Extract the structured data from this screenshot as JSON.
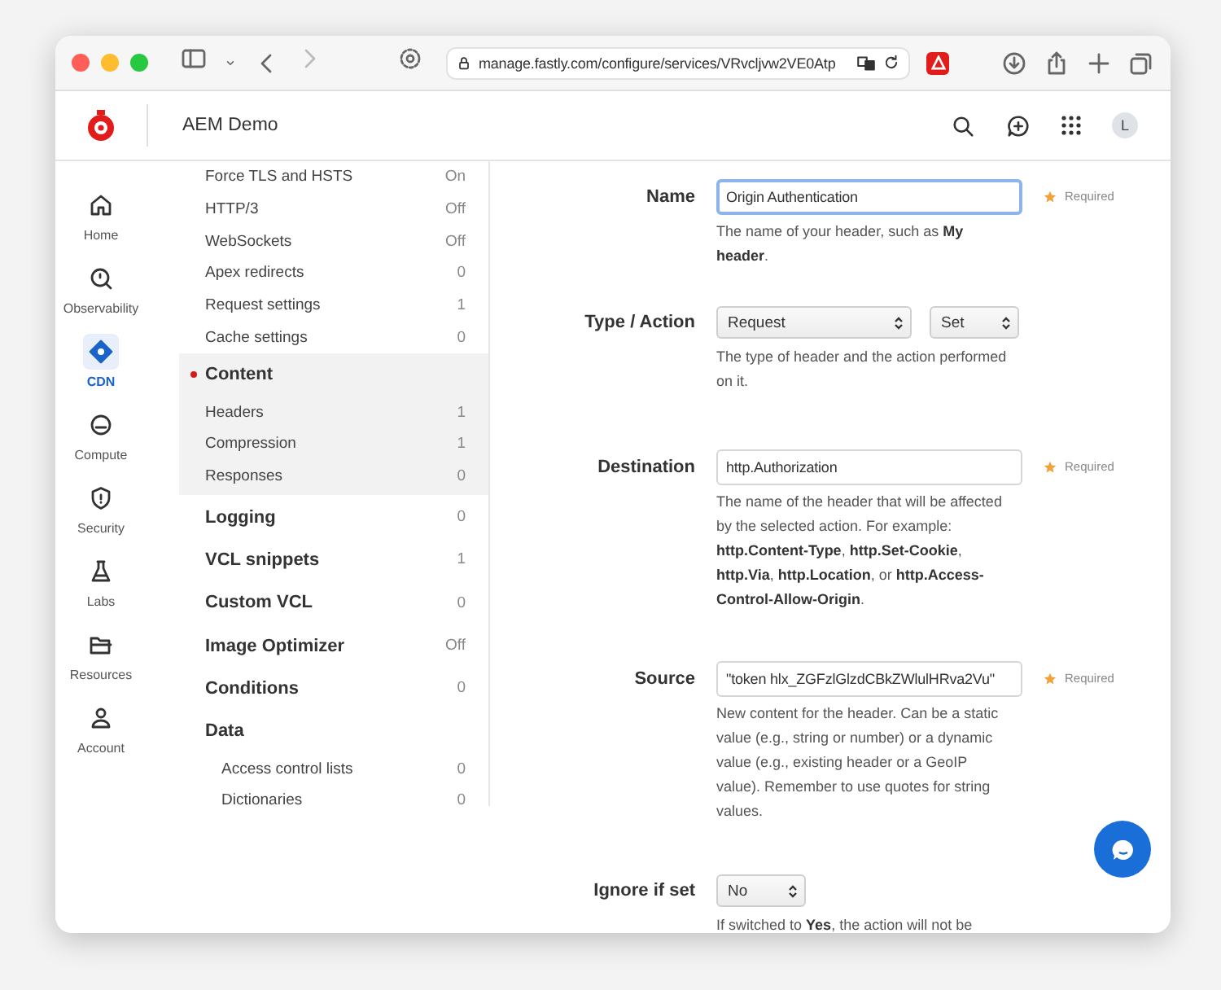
{
  "browser": {
    "url": "manage.fastly.com/configure/services/VRvcljvw2VE0Atp"
  },
  "header": {
    "title": "AEM Demo",
    "avatar": "L"
  },
  "nav_rail": [
    {
      "label": "Home",
      "selected": false
    },
    {
      "label": "Observability",
      "selected": false
    },
    {
      "label": "CDN",
      "selected": true
    },
    {
      "label": "Compute",
      "selected": false
    },
    {
      "label": "Security",
      "selected": false
    },
    {
      "label": "Labs",
      "selected": false
    },
    {
      "label": "Resources",
      "selected": false
    },
    {
      "label": "Account",
      "selected": false
    }
  ],
  "sidebar": [
    {
      "kind": "item",
      "label": "Force TLS and HSTS",
      "value": "On",
      "selected": false
    },
    {
      "kind": "item",
      "label": "HTTP/3",
      "value": "Off",
      "selected": false
    },
    {
      "kind": "item",
      "label": "WebSockets",
      "value": "Off",
      "selected": false
    },
    {
      "kind": "item",
      "label": "Apex redirects",
      "value": "0",
      "selected": false
    },
    {
      "kind": "item",
      "label": "Request settings",
      "value": "1",
      "selected": false
    },
    {
      "kind": "item",
      "label": "Cache settings",
      "value": "0",
      "selected": false
    },
    {
      "kind": "section",
      "label": "Content",
      "selected": true,
      "children": [
        {
          "label": "Headers",
          "value": "1",
          "selected": false
        },
        {
          "label": "Compression",
          "value": "1",
          "selected": false
        },
        {
          "label": "Responses",
          "value": "0",
          "selected": false
        }
      ]
    },
    {
      "kind": "section",
      "label": "Logging",
      "value": "0",
      "selected": false
    },
    {
      "kind": "section",
      "label": "VCL snippets",
      "value": "1",
      "selected": false
    },
    {
      "kind": "section",
      "label": "Custom VCL",
      "value": "0",
      "selected": false
    },
    {
      "kind": "section",
      "label": "Image Optimizer",
      "value": "Off",
      "selected": false
    },
    {
      "kind": "section",
      "label": "Conditions",
      "value": "0",
      "selected": false
    },
    {
      "kind": "section",
      "label": "Data",
      "selected": false,
      "children": [
        {
          "label": "Access control lists",
          "value": "0",
          "selected": false
        },
        {
          "label": "Dictionaries",
          "value": "0",
          "selected": false
        }
      ]
    }
  ],
  "form": [
    {
      "kind": "text",
      "label": "Name",
      "value": "Origin Authentication",
      "focused": true,
      "required": "Required",
      "help": "The name of your header, such as **My header**."
    },
    {
      "kind": "selects",
      "label": "Type / Action",
      "selects": [
        "Request",
        "Set"
      ],
      "help": "The type of header and the action performed on it."
    },
    {
      "kind": "text",
      "label": "Destination",
      "value": "http.Authorization",
      "focused": false,
      "required": "Required",
      "help": "The name of the header that will be affected by the selected action. For example: **http.Content-Type**, **http.Set-Cookie**, **http.Via**, **http.Location**, or **http.Access-Control-Allow-Origin**."
    },
    {
      "kind": "text",
      "label": "Source",
      "value": "\"token hlx_ZGFzlGlzdCBkZWlulHRva2Vu\"",
      "focused": false,
      "required": "Required",
      "help": "New content for the header. Can be a static value (e.g., string or number) or a dynamic value (e.g., existing header or a GeoIP value). Remember to use quotes for string values."
    },
    {
      "kind": "selects",
      "label": "Ignore if set",
      "selects": [
        "No"
      ],
      "help": "If switched to **Yes**, the action will not be"
    }
  ]
}
